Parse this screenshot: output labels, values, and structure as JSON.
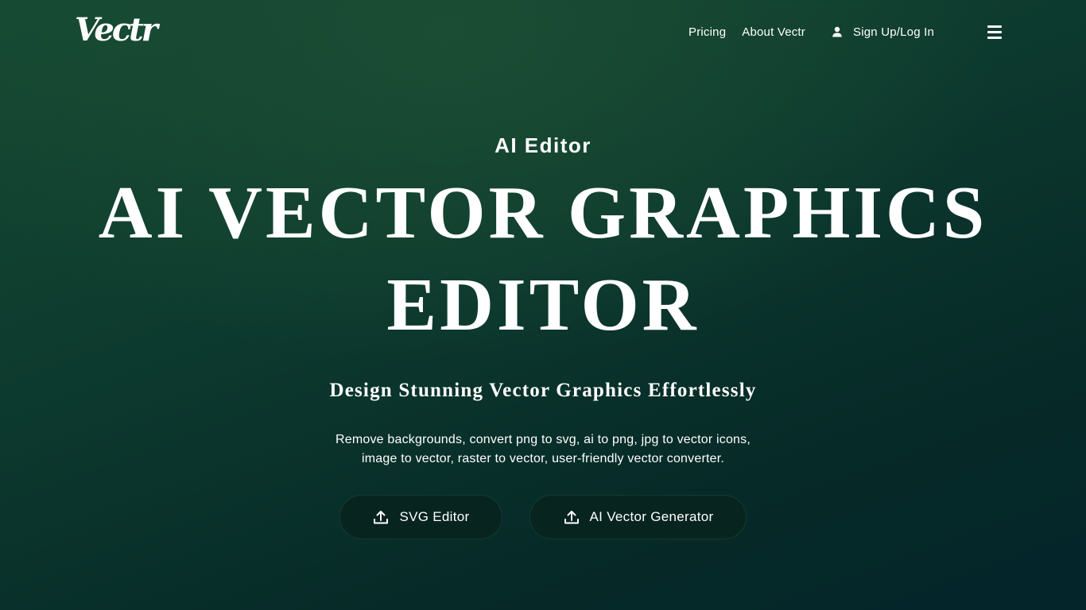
{
  "header": {
    "logo": "Vectr",
    "nav": {
      "pricing": "Pricing",
      "about": "About Vectr",
      "signup": "Sign Up/Log In"
    }
  },
  "hero": {
    "kicker": "AI Editor",
    "title_line1": "AI VECTOR GRAPHICS",
    "title_line2": "EDITOR",
    "subtitle": "Design Stunning Vector Graphics Effortlessly",
    "description_line1": "Remove backgrounds, convert png to svg, ai to png, jpg to vector icons,",
    "description_line2": "image to vector, raster to vector, user-friendly vector converter.",
    "buttons": {
      "svg_editor": "SVG Editor",
      "ai_generator": "AI Vector Generator"
    }
  },
  "icons": {
    "user": "user-icon",
    "menu": "hamburger-menu-icon",
    "upload": "upload-icon"
  },
  "colors": {
    "background_top": "#164a33",
    "background_bottom": "#04252a",
    "button_bg": "#08241f",
    "text": "#ffffff"
  }
}
